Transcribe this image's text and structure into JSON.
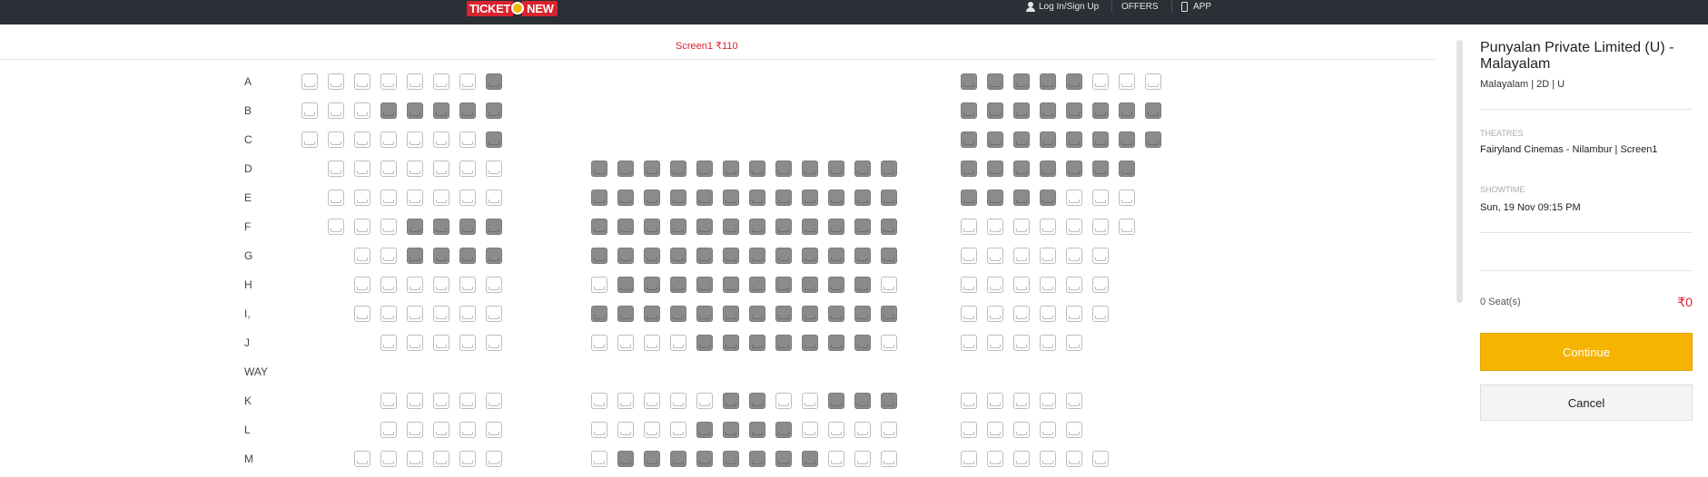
{
  "header": {
    "logo_part1": "TICKET",
    "logo_part2": "NEW",
    "login_label": "Log In/Sign Up",
    "offers_label": "OFFERS",
    "app_label": "APP"
  },
  "screen": {
    "label": "Screen1 ₹110"
  },
  "seat_rows": [
    {
      "label": "A",
      "blocks": [
        [
          1,
          1,
          1,
          1,
          1,
          1,
          1,
          2
        ],
        [],
        [
          2,
          2,
          2,
          2,
          2,
          1,
          1,
          1
        ]
      ]
    },
    {
      "label": "B",
      "blocks": [
        [
          1,
          1,
          1,
          2,
          2,
          2,
          2,
          2
        ],
        [],
        [
          2,
          2,
          2,
          2,
          2,
          2,
          2,
          2
        ]
      ]
    },
    {
      "label": "C",
      "blocks": [
        [
          1,
          1,
          1,
          1,
          1,
          1,
          1,
          2
        ],
        [],
        [
          2,
          2,
          2,
          2,
          2,
          2,
          2,
          2
        ]
      ]
    },
    {
      "label": "D",
      "blocks": [
        [
          0,
          1,
          1,
          1,
          1,
          1,
          1,
          1
        ],
        [
          2,
          2,
          2,
          2,
          2,
          2,
          2,
          2,
          2,
          2,
          2,
          2
        ],
        [
          2,
          2,
          2,
          2,
          2,
          2,
          2,
          0
        ]
      ]
    },
    {
      "label": "E",
      "blocks": [
        [
          0,
          1,
          1,
          1,
          1,
          1,
          1,
          1
        ],
        [
          2,
          2,
          2,
          2,
          2,
          2,
          2,
          2,
          2,
          2,
          2,
          2
        ],
        [
          2,
          2,
          2,
          2,
          1,
          1,
          1,
          0
        ]
      ]
    },
    {
      "label": "F",
      "blocks": [
        [
          0,
          1,
          1,
          1,
          2,
          2,
          2,
          2
        ],
        [
          2,
          2,
          2,
          2,
          2,
          2,
          2,
          2,
          2,
          2,
          2,
          2
        ],
        [
          1,
          1,
          1,
          1,
          1,
          1,
          1,
          0
        ]
      ]
    },
    {
      "label": "G",
      "blocks": [
        [
          0,
          0,
          1,
          1,
          2,
          2,
          2,
          2
        ],
        [
          2,
          2,
          2,
          2,
          2,
          2,
          2,
          2,
          2,
          2,
          2,
          2
        ],
        [
          1,
          1,
          1,
          1,
          1,
          1,
          0,
          0
        ]
      ]
    },
    {
      "label": "H",
      "blocks": [
        [
          0,
          0,
          1,
          1,
          1,
          1,
          1,
          1
        ],
        [
          1,
          2,
          2,
          2,
          2,
          2,
          2,
          2,
          2,
          2,
          2,
          1
        ],
        [
          1,
          1,
          1,
          1,
          1,
          1,
          0,
          0
        ]
      ]
    },
    {
      "label": "I,",
      "blocks": [
        [
          0,
          0,
          1,
          1,
          1,
          1,
          1,
          1
        ],
        [
          2,
          2,
          2,
          2,
          2,
          2,
          2,
          2,
          2,
          2,
          2,
          2
        ],
        [
          1,
          1,
          1,
          1,
          1,
          1,
          0,
          0
        ]
      ]
    },
    {
      "label": "J",
      "blocks": [
        [
          0,
          0,
          0,
          1,
          1,
          1,
          1,
          1
        ],
        [
          1,
          1,
          1,
          1,
          2,
          2,
          2,
          2,
          2,
          2,
          2,
          1
        ],
        [
          1,
          1,
          1,
          1,
          1,
          0,
          0,
          0
        ]
      ]
    },
    {
      "label": "WAY",
      "blocks": [
        [],
        [],
        []
      ]
    },
    {
      "label": "K",
      "blocks": [
        [
          0,
          0,
          0,
          1,
          1,
          1,
          1,
          1
        ],
        [
          1,
          1,
          1,
          1,
          1,
          2,
          2,
          1,
          1,
          2,
          2,
          2
        ],
        [
          1,
          1,
          1,
          1,
          1,
          0,
          0,
          0
        ]
      ]
    },
    {
      "label": "L",
      "blocks": [
        [
          0,
          0,
          0,
          1,
          1,
          1,
          1,
          1
        ],
        [
          1,
          1,
          1,
          1,
          2,
          2,
          2,
          2,
          1,
          1,
          1,
          1
        ],
        [
          1,
          1,
          1,
          1,
          1,
          0,
          0,
          0
        ]
      ]
    },
    {
      "label": "M",
      "blocks": [
        [
          0,
          0,
          1,
          1,
          1,
          1,
          1,
          1
        ],
        [
          1,
          2,
          2,
          2,
          2,
          2,
          2,
          2,
          2,
          1,
          1,
          1
        ],
        [
          1,
          1,
          1,
          1,
          1,
          1,
          0,
          0
        ]
      ]
    }
  ],
  "seat_legend": {
    "0": "none",
    "1": "available",
    "2": "sold"
  },
  "sidebar": {
    "movie_title": "Punyalan Private Limited (U) - Malayalam",
    "movie_meta": "Malayalam | 2D | U",
    "theatres_label": "THEATRES",
    "theatre_value": "Fairyland Cinemas - Nilambur | Screen1",
    "showtime_label": "SHOWTIME",
    "showtime_value": "Sun, 19 Nov 09:15 PM",
    "seat_count": "0 Seat(s)",
    "amount": "₹0",
    "continue_label": "Continue",
    "cancel_label": "Cancel"
  },
  "colors": {
    "topbar": "#2b2f36",
    "accent_red": "#d9232e",
    "continue_yellow": "#f5b400",
    "sold_seat": "#8b8b8b"
  }
}
